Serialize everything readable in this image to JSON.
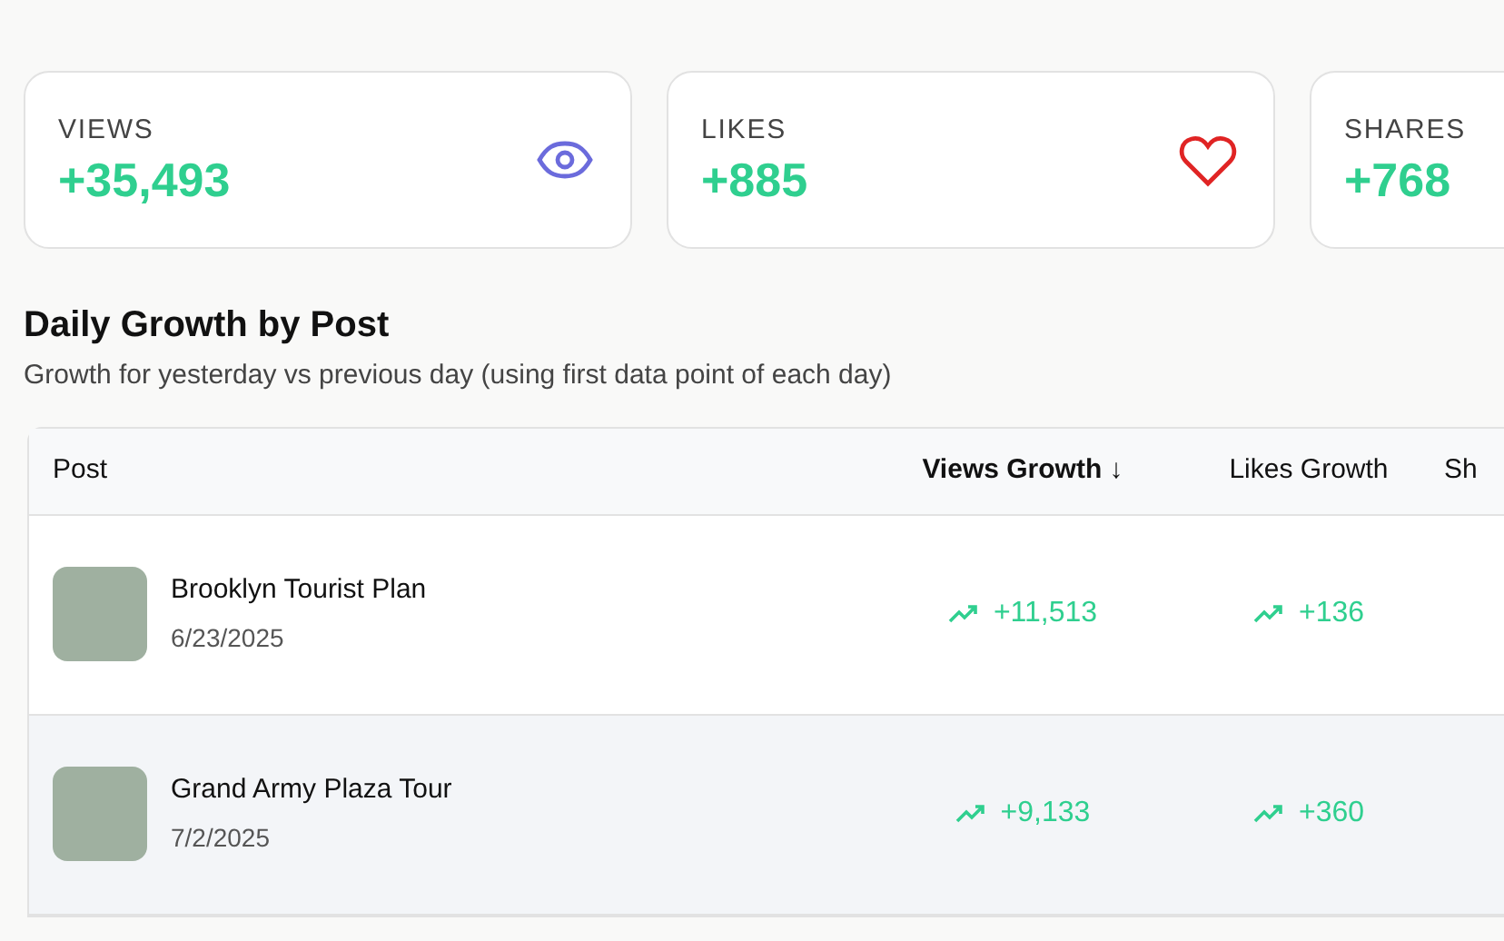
{
  "stats": [
    {
      "label": "VIEWS",
      "value": "+35,493"
    },
    {
      "label": "LIKES",
      "value": "+885"
    },
    {
      "label": "SHARES",
      "value": "+768"
    }
  ],
  "section": {
    "title": "Daily Growth by Post",
    "subtitle": "Growth for yesterday vs previous day (using first data point of each day)"
  },
  "table": {
    "columns": [
      {
        "label": "Post",
        "sorted": false
      },
      {
        "label": "Views Growth",
        "sorted": true,
        "sort_icon": "↓"
      },
      {
        "label": "Likes Growth",
        "sorted": false
      },
      {
        "label": "Sh",
        "sorted": false
      }
    ],
    "rows": [
      {
        "title": "Brooklyn Tourist Plan",
        "date": "6/23/2025",
        "views_growth": "+11,513",
        "likes_growth": "+136",
        "highlighted": false
      },
      {
        "title": "Grand Army Plaza Tour",
        "date": "7/2/2025",
        "views_growth": "+9,133",
        "likes_growth": "+360",
        "highlighted": true
      }
    ]
  }
}
